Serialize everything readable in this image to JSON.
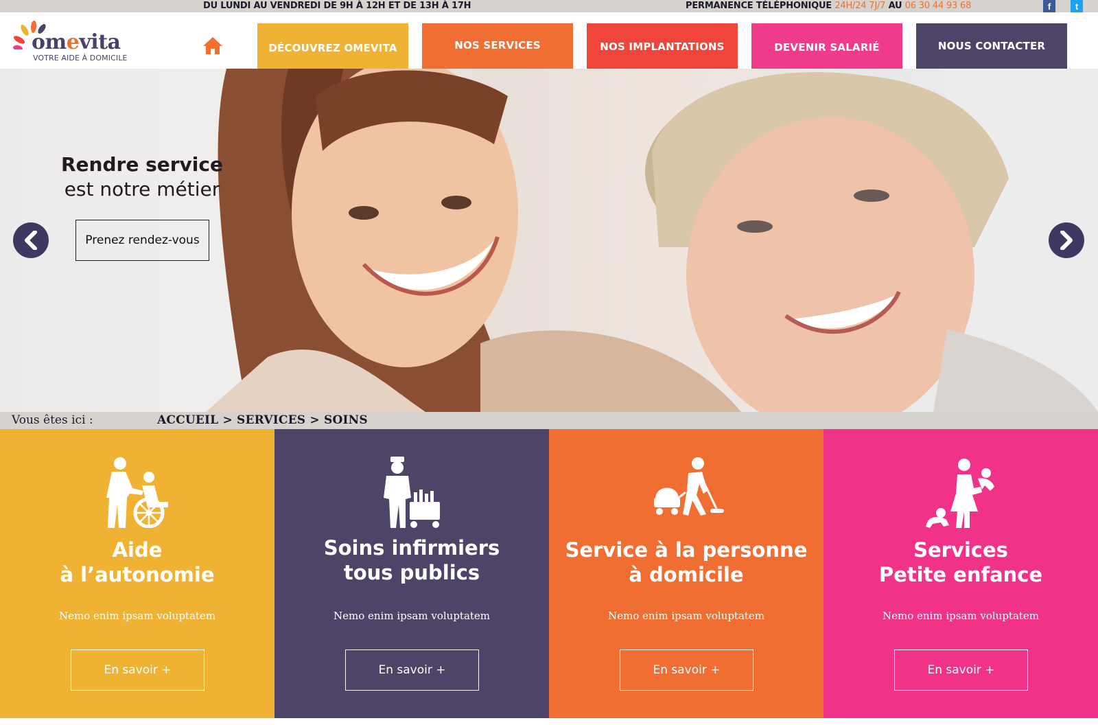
{
  "topbar": {
    "hours": "DU LUNDI AU VENDREDI DE 9H À 12H ET DE 13H À 17H",
    "phone_prefix": "PERMANENCE TÉLÉPHONIQUE",
    "phone_availability": "24H/24 7J/7",
    "phone_middle": "AU",
    "phone_number": "06 30 44 93 68",
    "social": [
      {
        "name": "facebook-icon",
        "glyph": "f"
      },
      {
        "name": "twitter-icon",
        "glyph": "t"
      }
    ]
  },
  "header": {
    "logo": {
      "brand_start": "om",
      "brand_accent": "e",
      "brand_end": "vita",
      "tagline": "VOTRE AIDE À DOMICILE"
    },
    "nav": [
      {
        "label": "DÉCOUVREZ OMEVITA",
        "color": "#f0b232"
      },
      {
        "label": "NOS SERVICES",
        "color": "#f06e32"
      },
      {
        "label": "NOS IMPLANTATIONS",
        "color": "#f0453a"
      },
      {
        "label": "DEVENIR SALARIÉ",
        "color": "#f03a8a"
      },
      {
        "label": "NOUS CONTACTER",
        "color": "#4d4467"
      }
    ]
  },
  "hero": {
    "headline_bold": "Rendre service",
    "headline_regular": "est notre métier",
    "cta_label": "Prenez rendez-vous"
  },
  "breadcrumb": {
    "label": "Vous êtes ici :",
    "path": "ACCUEIL > SERVICES > SOINS"
  },
  "services": [
    {
      "title_line1": "Aide",
      "title_line2": "à l’autonomie",
      "description": "Nemo enim ipsam voluptatem",
      "button": "En savoir +",
      "icon": "wheelchair-caregiver-icon",
      "color": "#f0b232"
    },
    {
      "title_line1": "Soins infirmiers",
      "title_line2": "tous publics",
      "description": "Nemo enim ipsam voluptatem",
      "button": "En savoir +",
      "icon": "nurse-trolley-icon",
      "color": "#4d4467"
    },
    {
      "title_line1": "Service à la personne",
      "title_line2": "à domicile",
      "description": "Nemo enim ipsam voluptatem",
      "button": "En savoir +",
      "icon": "vacuum-cleaning-icon",
      "color": "#f06e32"
    },
    {
      "title_line1": "Services",
      "title_line2": "Petite enfance",
      "description": "Nemo enim ipsam voluptatem",
      "button": "En savoir +",
      "icon": "parent-children-icon",
      "color": "#f03289"
    }
  ]
}
